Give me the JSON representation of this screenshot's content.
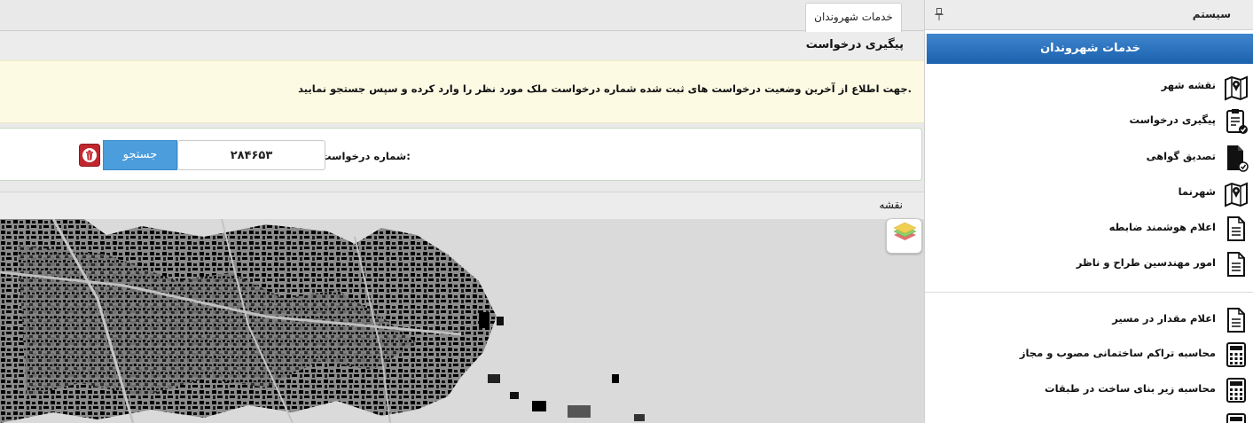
{
  "sidebar": {
    "header_title": "سیستم",
    "section_title": "خدمات شهروندان",
    "items": [
      {
        "label": "نقشه شهر",
        "icon": "map-pin-icon"
      },
      {
        "label": "پیگیری درخواست",
        "icon": "clipboard-check-icon"
      },
      {
        "label": "تصدیق گواهی",
        "icon": "document-check-icon"
      },
      {
        "label": "شهرنما",
        "icon": "map-pin-icon"
      },
      {
        "label": "اعلام هوشمند ضابطه",
        "icon": "document-icon"
      },
      {
        "label": "امور مهندسین طراح و ناظر",
        "icon": "document-icon"
      },
      {
        "label": "اعلام مقدار در مسیر",
        "icon": "document-icon"
      },
      {
        "label": "محاسبه تراکم ساختمانی مصوب و مجاز",
        "icon": "calculator-icon"
      },
      {
        "label": "محاسبه زیر بنای ساخت در طبقات",
        "icon": "calculator-icon"
      }
    ]
  },
  "tabs": [
    {
      "label": "خدمات شهروندان",
      "active": true
    }
  ],
  "main": {
    "page_title": "پیگیری درخواست",
    "notice": ".جهت اطلاع از آخرین وضعیت درخواست های ثبت شده شماره درخواست ملک مورد نظر را وارد کرده و سپس جستجو نمایید",
    "form": {
      "label": "شماره درخواست:",
      "value": "۲۸۴۶۵۳",
      "search_button": "جستجو",
      "clear_icon": "trash-icon"
    },
    "map": {
      "title": "نقشه",
      "layers_icon": "layers-icon"
    }
  },
  "colors": {
    "accent": "#1f66b2",
    "search_button": "#4b9ddc",
    "notice_bg": "#fdfae4",
    "trash_button": "#c0272d"
  }
}
